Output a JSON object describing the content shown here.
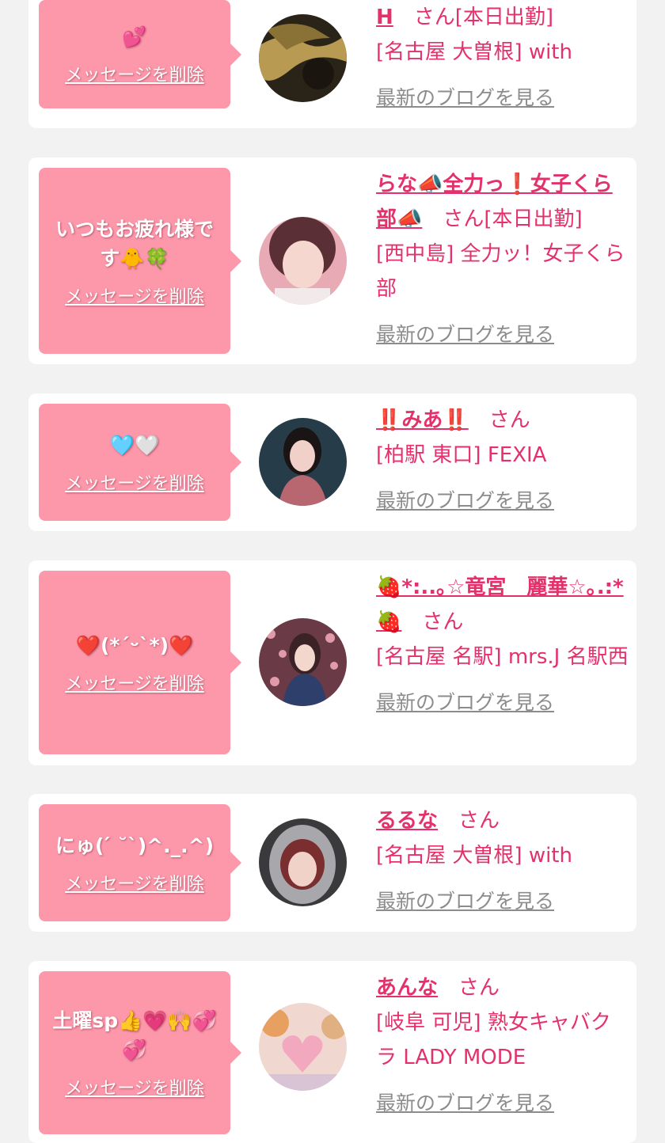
{
  "delete_label": "メッセージを削除",
  "san_label": "さん",
  "blog_label": "最新のブログを見る",
  "colors": {
    "message_bg": "#fd97aa",
    "accent": "#e5316b",
    "link_gray": "#8c8c8c",
    "page_bg": "#f2f2f2"
  },
  "cards": [
    {
      "message": "💕",
      "name": "H",
      "status": "[本日出勤]",
      "shop": "[名古屋 大曽根] with"
    },
    {
      "message": "いつもお疲れ様です🐥🍀",
      "name": "らな📣全力っ❗️女子くら部📣",
      "status": "[本日出勤]",
      "shop": "[西中島] 全力ッ！女子くら部"
    },
    {
      "message": "🩵🤍",
      "name": "‼️みあ‼️",
      "status": "",
      "shop": "[柏駅 東口] FEXIA"
    },
    {
      "message": "❤️(*´ᵕ`*)❤️",
      "name": "🍓*:..｡☆竜宮　麗華☆｡.:*🍓",
      "status": "",
      "shop": "[名古屋 名駅] mrs.J 名駅西"
    },
    {
      "message": "にゅ( ́ ˘`)^._.^)",
      "name": "るるな",
      "status": "",
      "shop": "[名古屋 大曽根] with"
    },
    {
      "message": "土曜sp👍💗🙌💞💞",
      "name": "あんな",
      "status": "",
      "shop": "[岐阜 可児] 熟女キャバクラ LADY MODE"
    }
  ]
}
